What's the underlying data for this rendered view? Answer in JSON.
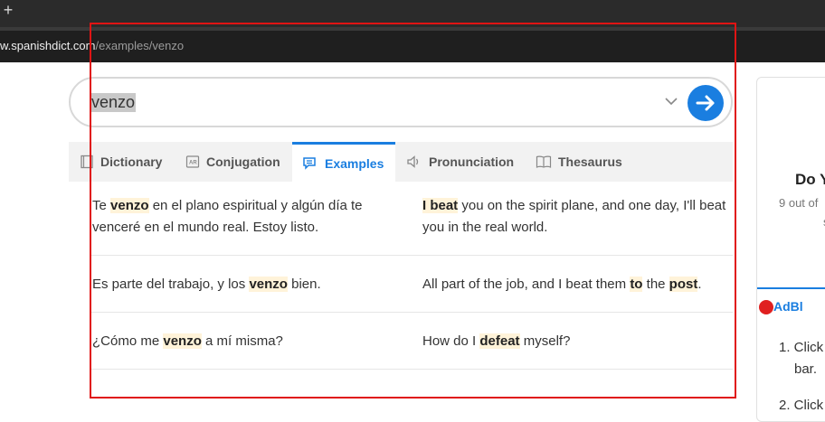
{
  "browser": {
    "new_tab_symbol": "+",
    "url_domain": "w.spanishdict.com",
    "url_path": "/examples/venzo"
  },
  "search": {
    "value": "venzo",
    "dropdown_icon": "chevron-down-icon",
    "submit_icon": "arrow-right-icon"
  },
  "tabs": [
    {
      "label": "Dictionary",
      "icon": "book-icon",
      "active": false
    },
    {
      "label": "Conjugation",
      "icon": "conjugation-icon",
      "active": false
    },
    {
      "label": "Examples",
      "icon": "chat-bubbles-icon",
      "active": true
    },
    {
      "label": "Pronunciation",
      "icon": "speaker-icon",
      "active": false
    },
    {
      "label": "Thesaurus",
      "icon": "open-book-icon",
      "active": false
    }
  ],
  "examples": [
    {
      "es": [
        [
          "Te ",
          false
        ],
        [
          "venzo",
          true
        ],
        [
          " en el plano espiritual y algún día te venceré en el mundo real. Estoy listo.",
          false
        ]
      ],
      "en": [
        [
          "I beat",
          true
        ],
        [
          " you on the spirit plane, and one day, I'll beat you in the real world.",
          false
        ]
      ]
    },
    {
      "es": [
        [
          "Es parte del trabajo, y los ",
          false
        ],
        [
          "venzo",
          true
        ],
        [
          " bien.",
          false
        ]
      ],
      "en": [
        [
          "All part of the job, and I beat them ",
          false
        ],
        [
          "to",
          true
        ],
        [
          " the ",
          false
        ],
        [
          "post",
          true
        ],
        [
          ".",
          false
        ]
      ]
    },
    {
      "es": [
        [
          "¿Cómo me ",
          false
        ],
        [
          "venzo",
          true
        ],
        [
          " a mí misma?",
          false
        ]
      ],
      "en": [
        [
          "How do I ",
          false
        ],
        [
          "defeat",
          true
        ],
        [
          " myself?",
          false
        ]
      ]
    }
  ],
  "right_panel": {
    "title": "Do Y",
    "subtitle": "9 out of",
    "subtitle2": "s",
    "ad_label": "AdBl",
    "steps": [
      "1. Click",
      "bar.",
      "2. Click"
    ]
  },
  "colors": {
    "accent": "#1a7ee0",
    "highlight": "#fff3d9",
    "annotation_box": "#e01414"
  }
}
